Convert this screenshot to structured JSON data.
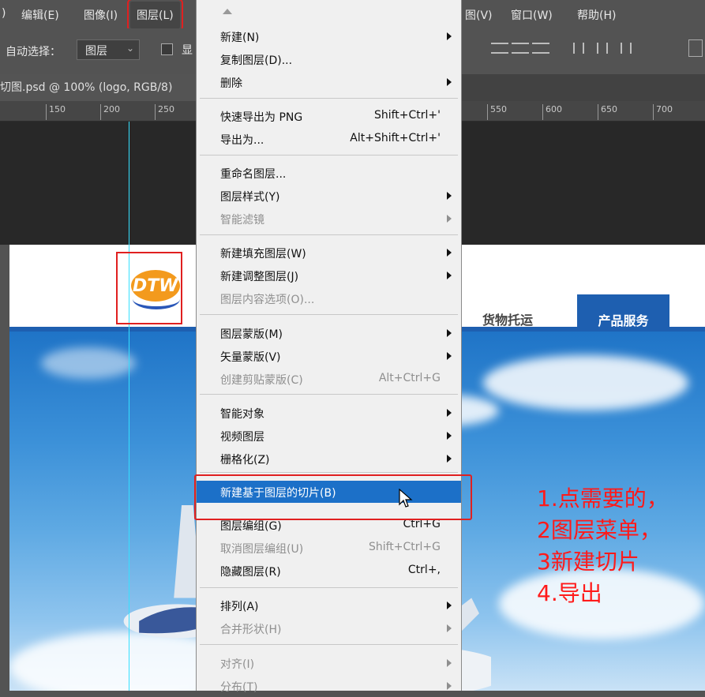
{
  "menubar": {
    "items": [
      "编辑(E)",
      "图像(I)",
      "图层(L)",
      "图(V)",
      "窗口(W)",
      "帮助(H)"
    ],
    "left_fragment": ")"
  },
  "options": {
    "auto_select_label": "自动选择：",
    "target_value": "图层",
    "show_label": "显"
  },
  "document": {
    "tab_title": "切图.psd @ 100% (logo, RGB/8)"
  },
  "ruler": {
    "ticks": [
      "150",
      "200",
      "250",
      "550",
      "600",
      "650",
      "700"
    ]
  },
  "site": {
    "logo_text": "DTW",
    "nav": [
      "货物托运",
      "产品服务"
    ]
  },
  "layer_menu": {
    "items": [
      {
        "label": "新建(N)",
        "shortcut": "",
        "submenu": true,
        "disabled": false
      },
      {
        "label": "复制图层(D)...",
        "shortcut": "",
        "submenu": false,
        "disabled": false
      },
      {
        "label": "删除",
        "shortcut": "",
        "submenu": true,
        "disabled": false
      },
      {
        "label": "快速导出为 PNG",
        "shortcut": "Shift+Ctrl+'",
        "submenu": false,
        "disabled": false
      },
      {
        "label": "导出为...",
        "shortcut": "Alt+Shift+Ctrl+'",
        "submenu": false,
        "disabled": false
      },
      {
        "label": "重命名图层...",
        "shortcut": "",
        "submenu": false,
        "disabled": false
      },
      {
        "label": "图层样式(Y)",
        "shortcut": "",
        "submenu": true,
        "disabled": false
      },
      {
        "label": "智能滤镜",
        "shortcut": "",
        "submenu": true,
        "disabled": true
      },
      {
        "label": "新建填充图层(W)",
        "shortcut": "",
        "submenu": true,
        "disabled": false
      },
      {
        "label": "新建调整图层(J)",
        "shortcut": "",
        "submenu": true,
        "disabled": false
      },
      {
        "label": "图层内容选项(O)...",
        "shortcut": "",
        "submenu": false,
        "disabled": true
      },
      {
        "label": "图层蒙版(M)",
        "shortcut": "",
        "submenu": true,
        "disabled": false
      },
      {
        "label": "矢量蒙版(V)",
        "shortcut": "",
        "submenu": true,
        "disabled": false
      },
      {
        "label": "创建剪贴蒙版(C)",
        "shortcut": "Alt+Ctrl+G",
        "submenu": false,
        "disabled": true
      },
      {
        "label": "智能对象",
        "shortcut": "",
        "submenu": true,
        "disabled": false
      },
      {
        "label": "视频图层",
        "shortcut": "",
        "submenu": true,
        "disabled": false
      },
      {
        "label": "栅格化(Z)",
        "shortcut": "",
        "submenu": true,
        "disabled": false
      },
      {
        "label": "新建基于图层的切片(B)",
        "shortcut": "",
        "submenu": false,
        "disabled": false,
        "highlighted": true
      },
      {
        "label": "图层编组(G)",
        "shortcut": "Ctrl+G",
        "submenu": false,
        "disabled": false
      },
      {
        "label": "取消图层编组(U)",
        "shortcut": "Shift+Ctrl+G",
        "submenu": false,
        "disabled": true
      },
      {
        "label": "隐藏图层(R)",
        "shortcut": "Ctrl+,",
        "submenu": false,
        "disabled": false
      },
      {
        "label": "排列(A)",
        "shortcut": "",
        "submenu": true,
        "disabled": false
      },
      {
        "label": "合并形状(H)",
        "shortcut": "",
        "submenu": true,
        "disabled": true
      },
      {
        "label": "对齐(I)",
        "shortcut": "",
        "submenu": true,
        "disabled": true
      },
      {
        "label": "分布(T)",
        "shortcut": "",
        "submenu": true,
        "disabled": true
      }
    ]
  },
  "annotation": {
    "lines": [
      "1.点需要的，",
      "2图层菜单，",
      "3新建切片",
      "4.导出"
    ],
    "color": "#ff1a1a"
  },
  "colors": {
    "menu_highlight": "#1c70c8",
    "nav_active_bg": "#1e5fb0",
    "guide": "#35e0ff",
    "annotation_box": "#e02020"
  }
}
